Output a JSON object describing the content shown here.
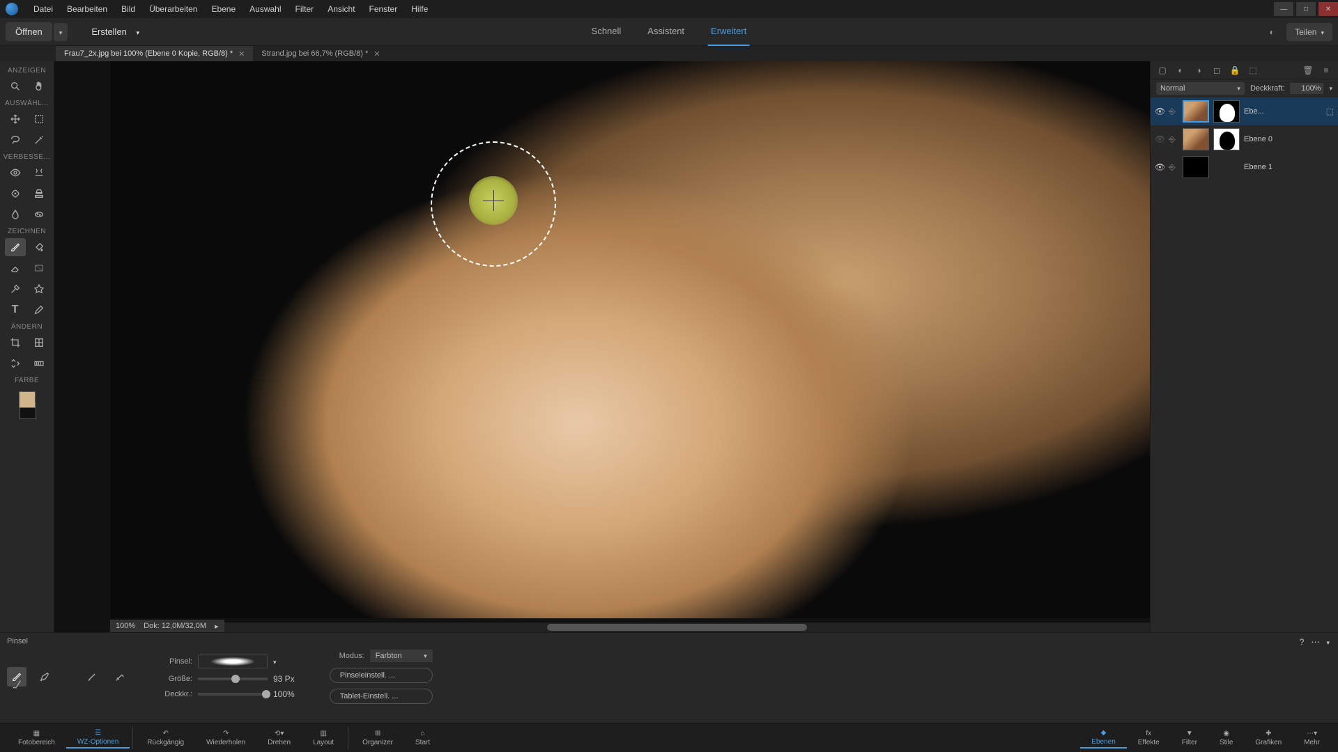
{
  "menu": [
    "Datei",
    "Bearbeiten",
    "Bild",
    "Überarbeiten",
    "Ebene",
    "Auswahl",
    "Filter",
    "Ansicht",
    "Fenster",
    "Hilfe"
  ],
  "toolbar": {
    "open": "Öffnen",
    "create": "Erstellen",
    "share": "Teilen"
  },
  "modes": {
    "quick": "Schnell",
    "guided": "Assistent",
    "expert": "Erweitert"
  },
  "docTabs": [
    {
      "label": "Frau7_2x.jpg bei 100% (Ebene 0 Kopie, RGB/8) *",
      "active": true
    },
    {
      "label": "Strand.jpg bei 66,7% (RGB/8) *",
      "active": false
    }
  ],
  "leftSections": {
    "view": "ANZEIGEN",
    "select": "AUSWÄHL...",
    "enhance": "VERBESSE...",
    "draw": "ZEICHNEN",
    "modify": "ÄNDERN",
    "color": "FARBE"
  },
  "status": {
    "zoom": "100%",
    "doc": "Dok: 12,0M/32,0M"
  },
  "layersPanel": {
    "blendMode": "Normal",
    "opacityLabel": "Deckkraft:",
    "opacityValue": "100%",
    "layers": [
      {
        "name": "Ebe...",
        "active": true,
        "hasPhoto": true,
        "hasMask": true,
        "maskInverted": true
      },
      {
        "name": "Ebene 0",
        "active": false,
        "hasPhoto": true,
        "hasMask": true,
        "maskInverted": false
      },
      {
        "name": "Ebene 1",
        "active": false,
        "hasPhoto": false,
        "hasMask": false,
        "maskInverted": false
      }
    ]
  },
  "options": {
    "toolName": "Pinsel",
    "brushLabel": "Pinsel:",
    "modeLabel": "Modus:",
    "modeValue": "Farbton",
    "sizeLabel": "Größe:",
    "sizeValue": "93 Px",
    "opacityLabel": "Deckkr.:",
    "opacityValue": "100%",
    "brushSettings": "Pinseleinstell. ...",
    "tabletSettings": "Tablet-Einstell. ..."
  },
  "bottomLeft": [
    {
      "label": "Fotobereich",
      "icon": "image"
    },
    {
      "label": "WZ-Optionen",
      "icon": "options",
      "active": true
    },
    {
      "label": "Rückgängig",
      "icon": "undo"
    },
    {
      "label": "Wiederholen",
      "icon": "redo"
    },
    {
      "label": "Drehen",
      "icon": "rotate"
    },
    {
      "label": "Layout",
      "icon": "layout"
    },
    {
      "label": "Organizer",
      "icon": "organizer"
    },
    {
      "label": "Start",
      "icon": "home"
    }
  ],
  "bottomRight": [
    {
      "label": "Ebenen",
      "icon": "layers",
      "active": true
    },
    {
      "label": "Effekte",
      "icon": "fx"
    },
    {
      "label": "Filter",
      "icon": "filter"
    },
    {
      "label": "Stile",
      "icon": "styles"
    },
    {
      "label": "Grafiken",
      "icon": "graphics"
    },
    {
      "label": "Mehr",
      "icon": "more"
    }
  ]
}
